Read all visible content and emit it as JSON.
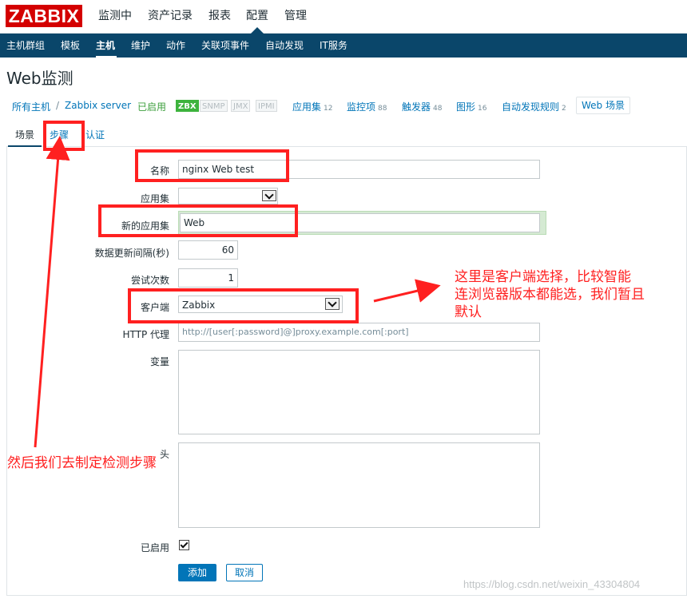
{
  "logo": "ZABBIX",
  "top_menu": [
    "监测中",
    "资产记录",
    "报表",
    "配置",
    "管理"
  ],
  "sub_menu": [
    "主机群组",
    "模板",
    "主机",
    "维护",
    "动作",
    "关联项事件",
    "自动发现",
    "IT服务"
  ],
  "page_title": "Web监测",
  "breadcrumb": {
    "all_hosts": "所有主机",
    "sep": "/",
    "host": "Zabbix server",
    "status": "已启用",
    "availability": [
      "ZBX",
      "SNMP",
      "JMX",
      "IPMI"
    ],
    "links": [
      {
        "label": "应用集",
        "count": "12"
      },
      {
        "label": "监控项",
        "count": "88"
      },
      {
        "label": "触发器",
        "count": "48"
      },
      {
        "label": "图形",
        "count": "16"
      },
      {
        "label": "自动发现规则",
        "count": "2"
      }
    ],
    "web_scenario": "Web 场景"
  },
  "tabs": [
    "场景",
    "步骤",
    "认证"
  ],
  "form": {
    "name_label": "名称",
    "name_value": "nginx Web test",
    "app_label": "应用集",
    "app_value": "",
    "newapp_label": "新的应用集",
    "newapp_value": "Web",
    "interval_label": "数据更新间隔(秒)",
    "interval_value": "60",
    "attempts_label": "尝试次数",
    "attempts_value": "1",
    "agent_label": "客户端",
    "agent_value": "Zabbix",
    "proxy_label": "HTTP 代理",
    "proxy_placeholder": "http://[user[:password]@]proxy.example.com[:port]",
    "vars_label": "变量",
    "headers_label": "头",
    "enabled_label": "已启用",
    "enabled": true,
    "add_button": "添加",
    "cancel_button": "取消"
  },
  "annotations": {
    "client_note": "这里是客户端选择，比较智能\n连浏览器版本都能选，我们暂且\n默认",
    "steps_note": "然后我们去制定检测步骤"
  },
  "watermark": "https://blog.csdn.net/weixin_43304804",
  "colors": {
    "brand_red": "#d40000",
    "nav_blue": "#0a466a",
    "link_blue": "#0275b8",
    "annotation_red": "#ff2020",
    "enabled_green": "#3db33d"
  }
}
